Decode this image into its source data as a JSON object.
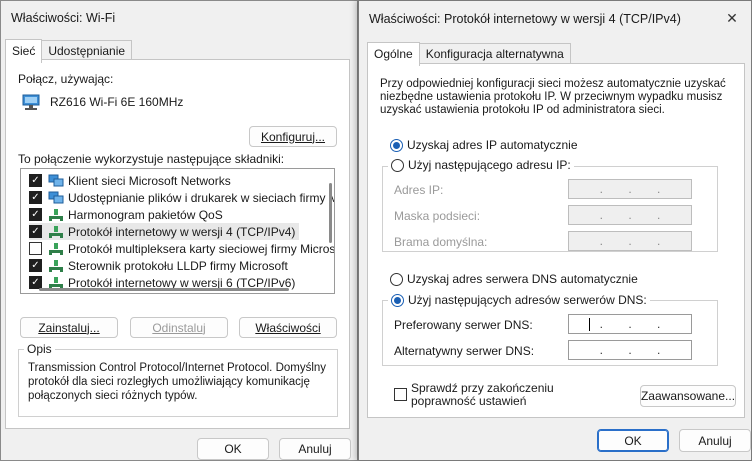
{
  "left_window": {
    "title": "Właściwości: Wi-Fi",
    "tabs": [
      "Sieć",
      "Udostępnianie"
    ],
    "connect_using_label": "Połącz, używając:",
    "adapter_name": "RZ616 Wi-Fi 6E 160MHz",
    "configure_button": "Konfiguruj...",
    "components_label": "To połączenie wykorzystuje następujące składniki:",
    "components": [
      {
        "label": "Klient sieci Microsoft Networks",
        "checked": true
      },
      {
        "label": "Udostępnianie plików i drukarek w sieciach firmy Micros",
        "checked": true
      },
      {
        "label": "Harmonogram pakietów QoS",
        "checked": true
      },
      {
        "label": "Protokół internetowy w wersji 4 (TCP/IPv4)",
        "checked": true
      },
      {
        "label": "Protokół multipleksera karty sieciowej firmy Microsoft",
        "checked": false
      },
      {
        "label": "Sterownik protokołu LLDP firmy Microsoft",
        "checked": true
      },
      {
        "label": "Protokół internetowy w wersji 6 (TCP/IPv6)",
        "checked": true
      }
    ],
    "install_button": "Zainstaluj...",
    "uninstall_button": "Odinstaluj",
    "properties_button": "Właściwości",
    "description_title": "Opis",
    "description_text": "Transmission Control Protocol/Internet Protocol. Domyślny protokół dla sieci rozległych umożliwiający komunikację połączonych sieci różnych typów.",
    "ok_button": "OK",
    "cancel_button": "Anuluj"
  },
  "right_window": {
    "title": "Właściwości: Protokół internetowy w wersji 4 (TCP/IPv4)",
    "close_glyph": "✕",
    "tabs": [
      "Ogólne",
      "Konfiguracja alternatywna"
    ],
    "intro_text": "Przy odpowiedniej konfiguracji sieci możesz automatycznie uzyskać niezbędne ustawienia protokołu IP. W przeciwnym wypadku musisz uzyskać ustawienia protokołu IP od administratora sieci.",
    "ip_auto_radio": "Uzyskaj adres IP automatycznie",
    "ip_manual_radio": "Użyj następującego adresu IP:",
    "ip_address_label": "Adres IP:",
    "subnet_label": "Maska podsieci:",
    "gateway_label": "Brama domyślna:",
    "dns_auto_radio": "Uzyskaj adres serwera DNS automatycznie",
    "dns_manual_radio": "Użyj następujących adresów serwerów DNS:",
    "preferred_dns_label": "Preferowany serwer DNS:",
    "alternate_dns_label": "Alternatywny serwer DNS:",
    "validate_checkbox": "Sprawdź przy zakończeniu poprawność ustawień",
    "advanced_button": "Zaawansowane...",
    "ok_button": "OK",
    "cancel_button": "Anuluj",
    "ip_selected": "auto",
    "dns_selected": "manual"
  },
  "colors": {
    "accent": "#1a5fb4",
    "dialog_bg": "#f0f0f0"
  },
  "icons": [
    "close-icon",
    "network-adapter-icon",
    "network-component-icon",
    "protocol-icon"
  ]
}
